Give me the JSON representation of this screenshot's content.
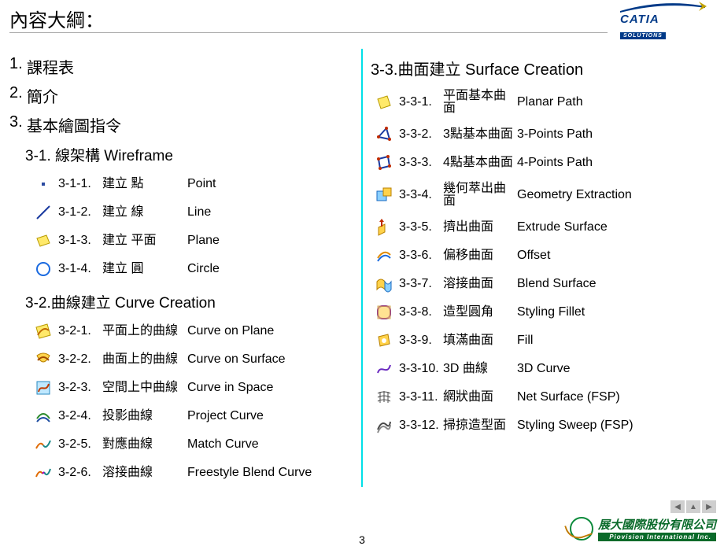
{
  "header": {
    "title": "內容大綱：",
    "brand_name": "CATIA",
    "brand_sub": "SOLUTIONS"
  },
  "left": {
    "top": [
      {
        "num": "1.",
        "label": "課程表"
      },
      {
        "num": "2.",
        "label": "簡介"
      },
      {
        "num": "3.",
        "label": "基本繪圖指令"
      }
    ],
    "s31_title": "3-1. 線架構   Wireframe",
    "s31": [
      {
        "idx": "3-1-1.",
        "zh": "建立 點",
        "en": "Point",
        "icon": "point"
      },
      {
        "idx": "3-1-2.",
        "zh": "建立 線",
        "en": "Line",
        "icon": "line"
      },
      {
        "idx": "3-1-3.",
        "zh": "建立 平面",
        "en": "   Plane",
        "icon": "plane"
      },
      {
        "idx": "3-1-4.",
        "zh": "建立 圓",
        "en": "Circle",
        "icon": "circle"
      }
    ],
    "s32_title": "3-2.曲線建立   Curve Creation",
    "s32": [
      {
        "idx": "3-2-1.",
        "zh": "平面上的曲線",
        "en": "Curve on Plane",
        "icon": "curve-plane"
      },
      {
        "idx": "3-2-2.",
        "zh": "曲面上的曲線",
        "en": "Curve on Surface",
        "icon": "curve-surface"
      },
      {
        "idx": "3-2-3.",
        "zh": "空間上中曲線",
        "en": "Curve in Space",
        "icon": "curve-space"
      },
      {
        "idx": "3-2-4.",
        "zh": "投影曲線",
        "en": "Project Curve",
        "icon": "project-curve"
      },
      {
        "idx": "3-2-5.",
        "zh": "對應曲線",
        "en": "Match Curve",
        "icon": "match-curve"
      },
      {
        "idx": "3-2-6.",
        "zh": "溶接曲線",
        "en": "Freestyle Blend Curve",
        "icon": "blend-curve"
      }
    ]
  },
  "right": {
    "s33_title": "3-3.曲面建立   Surface Creation",
    "s33": [
      {
        "idx": "3-3-1.",
        "zh": "平面基本曲面",
        "en": "Planar Path",
        "icon": "planar"
      },
      {
        "idx": "3-3-2.",
        "zh": "3點基本曲面",
        "en": "3-Points Path",
        "icon": "3pts"
      },
      {
        "idx": "3-3-3.",
        "zh": "4點基本曲面",
        "en": "4-Points Path",
        "icon": "4pts"
      },
      {
        "idx": "3-3-4.",
        "zh": "幾何萃出曲面",
        "en": "Geometry Extraction",
        "icon": "geo-extract"
      },
      {
        "idx": "3-3-5.",
        "zh": "擠出曲面",
        "en": "Extrude Surface",
        "icon": "extrude"
      },
      {
        "idx": "3-3-6.",
        "zh": "偏移曲面",
        "en": "Offset",
        "icon": "offset"
      },
      {
        "idx": "3-3-7.",
        "zh": "溶接曲面",
        "en": "Blend Surface",
        "icon": "blend-surf"
      },
      {
        "idx": "3-3-8.",
        "zh": "造型圓角",
        "en": "Styling Fillet",
        "icon": "fillet"
      },
      {
        "idx": "3-3-9.",
        "zh": "填滿曲面",
        "en": "Fill",
        "icon": "fill"
      },
      {
        "idx": "3-3-10.",
        "zh": "3D 曲線",
        "en": "3D Curve",
        "icon": "3d-curve"
      },
      {
        "idx": "3-3-11.",
        "zh": "網狀曲面",
        "en": "Net Surface (FSP)",
        "icon": "net"
      },
      {
        "idx": "3-3-12.",
        "zh": "掃掠造型面",
        "en": "Styling Sweep (FSP)",
        "icon": "sweep"
      }
    ]
  },
  "footer": {
    "page": "3",
    "company_zh": "展大國際股份有限公司",
    "company_en": "Piovision International Inc."
  }
}
